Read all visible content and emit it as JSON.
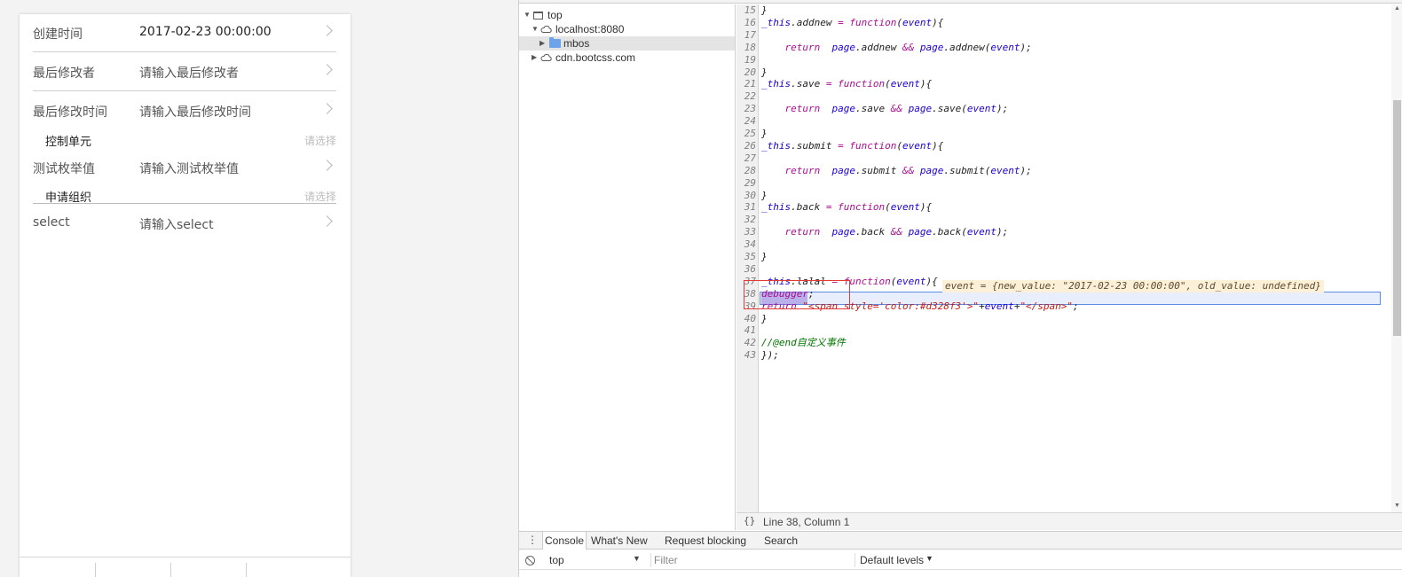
{
  "mobile_form": {
    "rows": [
      {
        "label": "创建时间",
        "value": "2017-02-23 00:00:00"
      },
      {
        "label": "最后修改者",
        "value": "请输入最后修改者"
      },
      {
        "label": "最后修改时间",
        "value": "请输入最后修改时间"
      },
      {
        "label": "控制单元",
        "placeholder": "请选择"
      },
      {
        "label": "测试枚举值",
        "value": "请输入测试枚举值"
      },
      {
        "label": "申请组织",
        "placeholder": "请选择"
      },
      {
        "label": "select",
        "value": "请输入select"
      }
    ]
  },
  "devtools": {
    "navigator": {
      "items": [
        {
          "label": "top"
        },
        {
          "label": "localhost:8080"
        },
        {
          "label": "mbos"
        },
        {
          "label": "cdn.bootcss.com"
        }
      ]
    },
    "editor": {
      "lines": [
        {
          "n": "15",
          "text": "}"
        },
        {
          "n": "16",
          "text": "_this.addnew = function(event){"
        },
        {
          "n": "17",
          "text": ""
        },
        {
          "n": "18",
          "text": "    return  page.addnew && page.addnew(event);"
        },
        {
          "n": "19",
          "text": ""
        },
        {
          "n": "20",
          "text": "}"
        },
        {
          "n": "21",
          "text": "_this.save = function(event){"
        },
        {
          "n": "22",
          "text": ""
        },
        {
          "n": "23",
          "text": "    return  page.save && page.save(event);"
        },
        {
          "n": "24",
          "text": ""
        },
        {
          "n": "25",
          "text": "}"
        },
        {
          "n": "26",
          "text": "_this.submit = function(event){"
        },
        {
          "n": "27",
          "text": ""
        },
        {
          "n": "28",
          "text": "    return  page.submit && page.submit(event);"
        },
        {
          "n": "29",
          "text": ""
        },
        {
          "n": "30",
          "text": "}"
        },
        {
          "n": "31",
          "text": "_this.back = function(event){"
        },
        {
          "n": "32",
          "text": ""
        },
        {
          "n": "33",
          "text": "    return  page.back && page.back(event);"
        },
        {
          "n": "34",
          "text": ""
        },
        {
          "n": "35",
          "text": "}"
        },
        {
          "n": "36",
          "text": ""
        },
        {
          "n": "37",
          "text": "_this.lalal = function(event){"
        },
        {
          "n": "38",
          "text": "debugger;"
        },
        {
          "n": "39",
          "text": "return \"<span style='color:#d328f3'>\"+event+\"</span>\";"
        },
        {
          "n": "40",
          "text": "}"
        },
        {
          "n": "41",
          "text": ""
        },
        {
          "n": "42",
          "text": "//@end自定义事件"
        },
        {
          "n": "43",
          "text": "});"
        }
      ],
      "inline_value": "event = {new_value: \"2017-02-23 00:00:00\", old_value: undefined}",
      "current_line": "38"
    },
    "status": {
      "position_text": "Line 38, Column 1",
      "format_icon_text": "{}"
    },
    "drawer": {
      "tabs": [
        "Console",
        "What's New",
        "Request blocking",
        "Search"
      ],
      "active_tab": "Console"
    },
    "console_toolbar": {
      "context": "top",
      "filter_placeholder": "Filter",
      "levels": "Default levels"
    }
  },
  "colors": {
    "keyword": "#aa0d91",
    "variable": "#1c00cf",
    "string": "#c41a16",
    "comment": "#007400",
    "exec_line_bg": "#e8eefc",
    "exec_line_border": "#5b8de6",
    "highlight_box": "#e53935"
  }
}
